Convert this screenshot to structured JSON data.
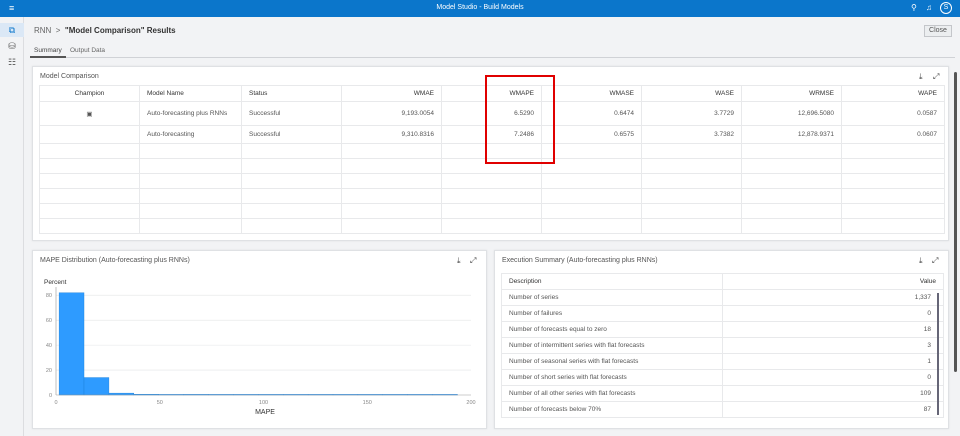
{
  "app": {
    "title": "Model Studio - Build Models",
    "user_initial": "S"
  },
  "breadcrumb": {
    "parent": "RNN",
    "separator": ">",
    "current": "\"Model Comparison\" Results"
  },
  "close_label": "Close",
  "tabs": [
    {
      "label": "Summary",
      "active": true
    },
    {
      "label": "Output Data",
      "active": false
    }
  ],
  "model_comparison": {
    "title": "Model Comparison",
    "columns": [
      "Champion",
      "Model Name",
      "Status",
      "WMAE",
      "WMAPE",
      "WMASE",
      "WASE",
      "WRMSE",
      "WAPE"
    ],
    "rows": [
      {
        "champion": true,
        "name": "Auto-forecasting plus RNNs",
        "status": "Successful",
        "wmae": "9,193.0054",
        "wmape": "6.5290",
        "wmase": "0.6474",
        "wase": "3.7729",
        "wrmse": "12,696.5080",
        "wape": "0.0587"
      },
      {
        "champion": false,
        "name": "Auto-forecasting",
        "status": "Successful",
        "wmae": "9,310.8316",
        "wmape": "7.2486",
        "wmase": "0.6575",
        "wase": "3.7382",
        "wrmse": "12,878.9371",
        "wape": "0.0607"
      }
    ],
    "champion_marker": "▣"
  },
  "mape_panel": {
    "title": "MAPE Distribution (Auto-forecasting plus RNNs)"
  },
  "chart_data": {
    "type": "bar",
    "title": "MAPE Distribution (Auto-forecasting plus RNNs)",
    "xlabel": "MAPE",
    "ylabel": "Percent",
    "xlim": [
      0,
      200
    ],
    "ylim": [
      0,
      85
    ],
    "xticks": [
      0,
      50,
      100,
      150,
      200
    ],
    "yticks": [
      0,
      20,
      40,
      60,
      80
    ],
    "bin_start": 1.5,
    "bin_width": 12,
    "values": [
      82,
      14,
      1.5,
      0.6,
      0.2,
      0.5,
      0.2,
      0.1,
      0.1,
      0.1,
      0.1,
      0.1,
      0.1,
      0.1,
      0.1,
      0.1
    ],
    "color": "#2e9bff",
    "grid": true
  },
  "exec_summary": {
    "title": "Execution Summary (Auto-forecasting plus RNNs)",
    "columns": [
      "Description",
      "Value"
    ],
    "rows": [
      [
        "Number of series",
        "1,337"
      ],
      [
        "Number of failures",
        "0"
      ],
      [
        "Number of forecasts equal to zero",
        "18"
      ],
      [
        "Number of intermittent series with flat forecasts",
        "3"
      ],
      [
        "Number of seasonal series with flat forecasts",
        "1"
      ],
      [
        "Number of short series with flat forecasts",
        "0"
      ],
      [
        "Number of all other series with flat forecasts",
        "109"
      ],
      [
        "Number of forecasts below 70%",
        "87"
      ]
    ]
  },
  "colors": {
    "brand": "#0b76cb",
    "highlight": "#e00000"
  }
}
